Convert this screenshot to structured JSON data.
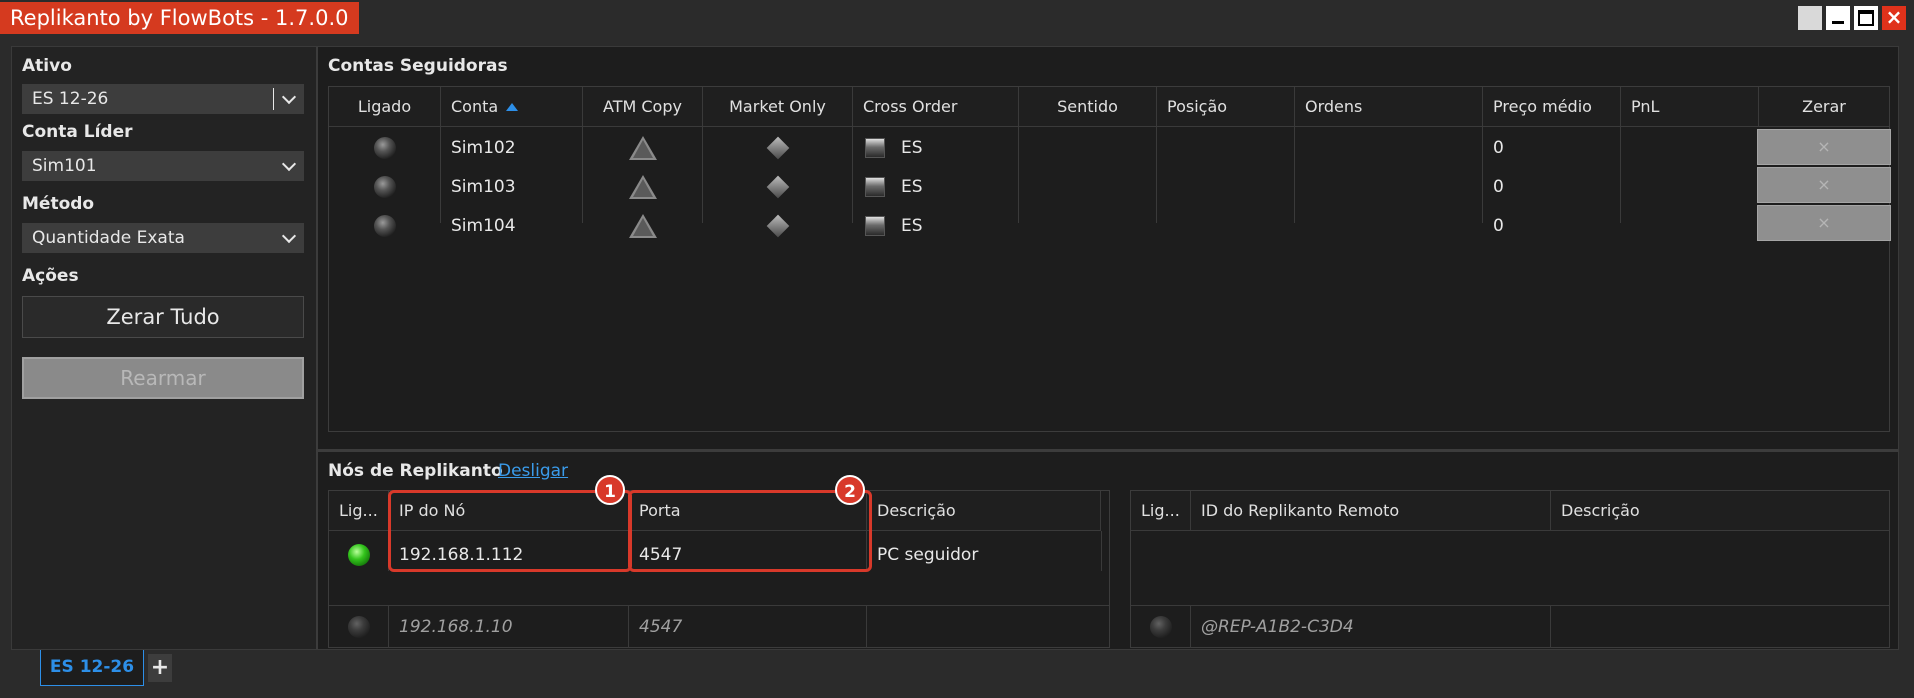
{
  "window": {
    "title": "Replikanto by FlowBots - 1.7.0.0"
  },
  "left": {
    "ativo_label": "Ativo",
    "ativo_value": "ES 12-26",
    "conta_lider_label": "Conta Líder",
    "conta_lider_value": "Sim101",
    "metodo_label": "Método",
    "metodo_value": "Quantidade Exata",
    "acoes_label": "Ações",
    "zerar_tudo": "Zerar Tudo",
    "rearmar": "Rearmar"
  },
  "followers": {
    "title": "Contas Seguidoras",
    "columns": [
      "Ligado",
      "Conta",
      "ATM Copy",
      "Market Only",
      "Cross Order",
      "Sentido",
      "Posição",
      "Ordens",
      "Preço médio",
      "PnL",
      "Zerar"
    ],
    "rows": [
      {
        "conta": "Sim102",
        "cross": "ES",
        "preco": "0",
        "zerar": "×"
      },
      {
        "conta": "Sim103",
        "cross": "ES",
        "preco": "0",
        "zerar": "×"
      },
      {
        "conta": "Sim104",
        "cross": "ES",
        "preco": "0",
        "zerar": "×"
      }
    ]
  },
  "nodes": {
    "title": "Nós de Replikanto",
    "disconnect_link": "Desligar",
    "left_columns": [
      "Lig...",
      "IP do Nó",
      "Porta",
      "Descrição"
    ],
    "left_rows": [
      {
        "ip": "192.168.1.112",
        "port": "4547",
        "desc": "PC seguidor"
      },
      {
        "ip": "192.168.1.10",
        "port": "4547",
        "desc": ""
      }
    ],
    "right_columns": [
      "Lig...",
      "ID do Replikanto Remoto",
      "Descrição"
    ],
    "right_rows": [
      {
        "id": "@REP-A1B2-C3D4",
        "desc": ""
      }
    ],
    "badges": [
      "1",
      "2"
    ]
  },
  "tabs": {
    "active": "ES 12-26",
    "add": "+"
  }
}
